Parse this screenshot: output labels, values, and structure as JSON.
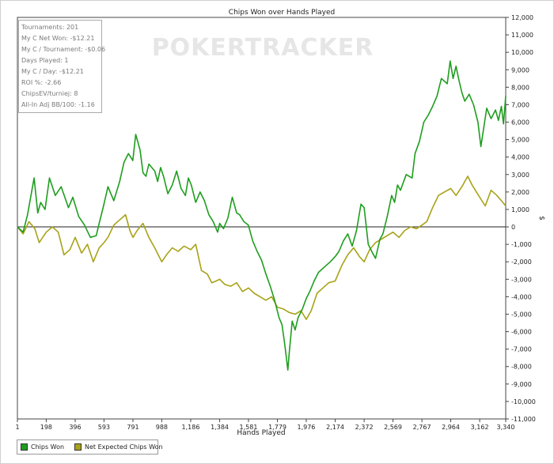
{
  "chart_data": {
    "type": "line",
    "title": "Chips Won over Hands Played",
    "xlabel": "Hands Played",
    "ylabel": "$",
    "watermark": "POKERTRACKER",
    "xlim": [
      1,
      3340
    ],
    "ylim": [
      -11000,
      12000
    ],
    "x_ticks": [
      1,
      198,
      396,
      593,
      791,
      988,
      1186,
      1384,
      1581,
      1779,
      1976,
      2174,
      2372,
      2569,
      2767,
      2964,
      3162,
      3340
    ],
    "x_tick_labels": [
      "1",
      "198",
      "396",
      "593",
      "791",
      "988",
      "1,186",
      "1,384",
      "1,581",
      "1,779",
      "1,976",
      "2,174",
      "2,372",
      "2,569",
      "2,767",
      "2,964",
      "3,162",
      "3,340"
    ],
    "y_ticks": [
      -11000,
      -10000,
      -9000,
      -8000,
      -7000,
      -6000,
      -5000,
      -4000,
      -3000,
      -2000,
      -1000,
      0,
      1000,
      2000,
      3000,
      4000,
      5000,
      6000,
      7000,
      8000,
      9000,
      10000,
      11000,
      12000
    ],
    "y_tick_labels": [
      "-11,000",
      "-10,000",
      "-9,000",
      "-8,000",
      "-7,000",
      "-6,000",
      "-5,000",
      "-4,000",
      "-3,000",
      "-2,000",
      "-1,000",
      "0",
      "1,000",
      "2,000",
      "3,000",
      "4,000",
      "5,000",
      "6,000",
      "7,000",
      "8,000",
      "9,000",
      "10,000",
      "11,000",
      "12,000"
    ],
    "grid": false,
    "zero_line": true,
    "legend_position": "bottom-left",
    "series": [
      {
        "name": "Chips Won",
        "color": "#1e9e1e",
        "x": [
          1,
          40,
          70,
          100,
          115,
          140,
          160,
          190,
          220,
          260,
          300,
          350,
          380,
          420,
          460,
          500,
          540,
          560,
          590,
          620,
          660,
          700,
          730,
          760,
          790,
          810,
          840,
          860,
          880,
          900,
          940,
          960,
          980,
          1000,
          1030,
          1060,
          1090,
          1120,
          1150,
          1170,
          1190,
          1220,
          1250,
          1280,
          1310,
          1340,
          1370,
          1384,
          1410,
          1440,
          1470,
          1500,
          1520,
          1550,
          1580,
          1610,
          1640,
          1670,
          1700,
          1730,
          1760,
          1790,
          1810,
          1830,
          1850,
          1860,
          1880,
          1900,
          1920,
          1950,
          1976,
          2000,
          2030,
          2060,
          2100,
          2140,
          2174,
          2200,
          2230,
          2260,
          2290,
          2320,
          2350,
          2372,
          2400,
          2430,
          2450,
          2480,
          2500,
          2530,
          2560,
          2580,
          2600,
          2620,
          2660,
          2700,
          2720,
          2750,
          2780,
          2810,
          2840,
          2870,
          2900,
          2940,
          2960,
          2980,
          3000,
          3020,
          3040,
          3060,
          3090,
          3120,
          3150,
          3170,
          3190,
          3210,
          3240,
          3270,
          3290,
          3310,
          3325,
          3340
        ],
        "values": [
          0,
          -300,
          700,
          2100,
          2800,
          800,
          1400,
          1000,
          2800,
          1800,
          2300,
          1100,
          1700,
          600,
          100,
          -600,
          -500,
          200,
          1200,
          2300,
          1500,
          2600,
          3700,
          4200,
          3800,
          5300,
          4400,
          3100,
          2900,
          3600,
          3200,
          2600,
          3400,
          2900,
          1900,
          2400,
          3200,
          2200,
          1800,
          2800,
          2400,
          1400,
          2000,
          1500,
          700,
          300,
          -300,
          200,
          -100,
          500,
          1700,
          800,
          700,
          300,
          100,
          -800,
          -1400,
          -1900,
          -2700,
          -3400,
          -4200,
          -5200,
          -5600,
          -6800,
          -8200,
          -7200,
          -5400,
          -5900,
          -5200,
          -4700,
          -4100,
          -3700,
          -3100,
          -2600,
          -2300,
          -2000,
          -1700,
          -1400,
          -800,
          -400,
          -1100,
          -200,
          1300,
          1100,
          -1000,
          -1500,
          -1800,
          -700,
          -400,
          600,
          1800,
          1400,
          2400,
          2100,
          3000,
          2800,
          4200,
          4900,
          6000,
          6400,
          6900,
          7500,
          8500,
          8200,
          9500,
          8500,
          9200,
          8400,
          7700,
          7200,
          7600,
          7000,
          6000,
          4600,
          5700,
          6800,
          6200,
          6700,
          6100,
          6900,
          5900,
          7500
        ]
      },
      {
        "name": "Net Expected Chips Won",
        "color": "#a8a218",
        "x": [
          1,
          40,
          80,
          120,
          150,
          198,
          240,
          280,
          320,
          360,
          396,
          440,
          480,
          520,
          560,
          593,
          620,
          660,
          700,
          740,
          770,
          791,
          820,
          860,
          900,
          940,
          970,
          988,
          1020,
          1060,
          1100,
          1140,
          1186,
          1220,
          1260,
          1300,
          1330,
          1360,
          1384,
          1420,
          1460,
          1500,
          1540,
          1581,
          1620,
          1660,
          1700,
          1740,
          1779,
          1820,
          1860,
          1900,
          1940,
          1976,
          2010,
          2050,
          2090,
          2130,
          2174,
          2220,
          2260,
          2300,
          2340,
          2372,
          2410,
          2450,
          2490,
          2530,
          2569,
          2610,
          2650,
          2690,
          2730,
          2767,
          2800,
          2840,
          2880,
          2920,
          2964,
          3000,
          3040,
          3080,
          3110,
          3140,
          3162,
          3200,
          3240,
          3280,
          3310,
          3340
        ],
        "values": [
          0,
          -400,
          300,
          -100,
          -900,
          -300,
          0,
          -300,
          -1600,
          -1300,
          -600,
          -1500,
          -1000,
          -2000,
          -1200,
          -900,
          -600,
          100,
          400,
          700,
          -200,
          -600,
          -200,
          200,
          -600,
          -1200,
          -1700,
          -2000,
          -1600,
          -1200,
          -1400,
          -1100,
          -1300,
          -1000,
          -2500,
          -2700,
          -3200,
          -3100,
          -3000,
          -3300,
          -3400,
          -3200,
          -3700,
          -3500,
          -3800,
          -4000,
          -4200,
          -4000,
          -4600,
          -4700,
          -4900,
          -5000,
          -4800,
          -5300,
          -4800,
          -3800,
          -3500,
          -3200,
          -3100,
          -2200,
          -1600,
          -1200,
          -1700,
          -2000,
          -1300,
          -900,
          -700,
          -500,
          -300,
          -600,
          -200,
          0,
          -100,
          100,
          300,
          1100,
          1800,
          2000,
          2200,
          1800,
          2300,
          2900,
          2400,
          2000,
          1700,
          1200,
          2100,
          1800,
          1500,
          1200
        ]
      }
    ],
    "stats_box": {
      "lines": [
        "Tournaments: 201",
        "My C Net Won: -$12.21",
        "My C / Tournament: -$0.06",
        "Days Played: 1",
        "My C / Day: -$12.21",
        "ROI %: -2.66",
        "ChipsEV/turniej: 8",
        "All-In Adj BB/100: -1.16"
      ]
    }
  }
}
